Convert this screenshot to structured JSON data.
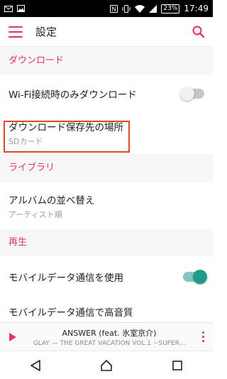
{
  "status_bar": {
    "battery": "23%",
    "time": "17:49",
    "icons": [
      "mail-icon",
      "image-icon",
      "nfc-icon",
      "vibrate-icon",
      "wifi-icon",
      "signal-icon",
      "battery-icon"
    ]
  },
  "app_bar": {
    "title": "設定",
    "menu_icon": "menu-icon",
    "search_icon": "search-icon"
  },
  "sections": {
    "download": {
      "header": "ダウンロード",
      "wifi_only": {
        "title": "Wi-Fi接続時のみダウンロード",
        "enabled": false
      },
      "save_location": {
        "title": "ダウンロード保存先の場所",
        "subtitle": "SDカード"
      }
    },
    "library": {
      "header": "ライブラリ",
      "album_sort": {
        "title": "アルバムの並べ替え",
        "subtitle": "アーティスト順"
      }
    },
    "playback": {
      "header": "再生",
      "mobile_data": {
        "title": "モバイルデータ通信を使用",
        "enabled": true
      },
      "mobile_hq": {
        "title": "モバイルデータ通信で高音質"
      }
    }
  },
  "player": {
    "title": "ANSWER (feat. 氷室京介)",
    "subtitle": "GLAY — THE GREAT VACATION VOL.1 ~SUPER..."
  },
  "colors": {
    "accent": "#e0336c",
    "toggle_on": "#1e9b8a",
    "highlight": "#e04a23",
    "section_bg": "#f7f7f7"
  },
  "nav": {
    "back": "back-icon",
    "home": "home-icon",
    "recents": "recents-icon"
  }
}
